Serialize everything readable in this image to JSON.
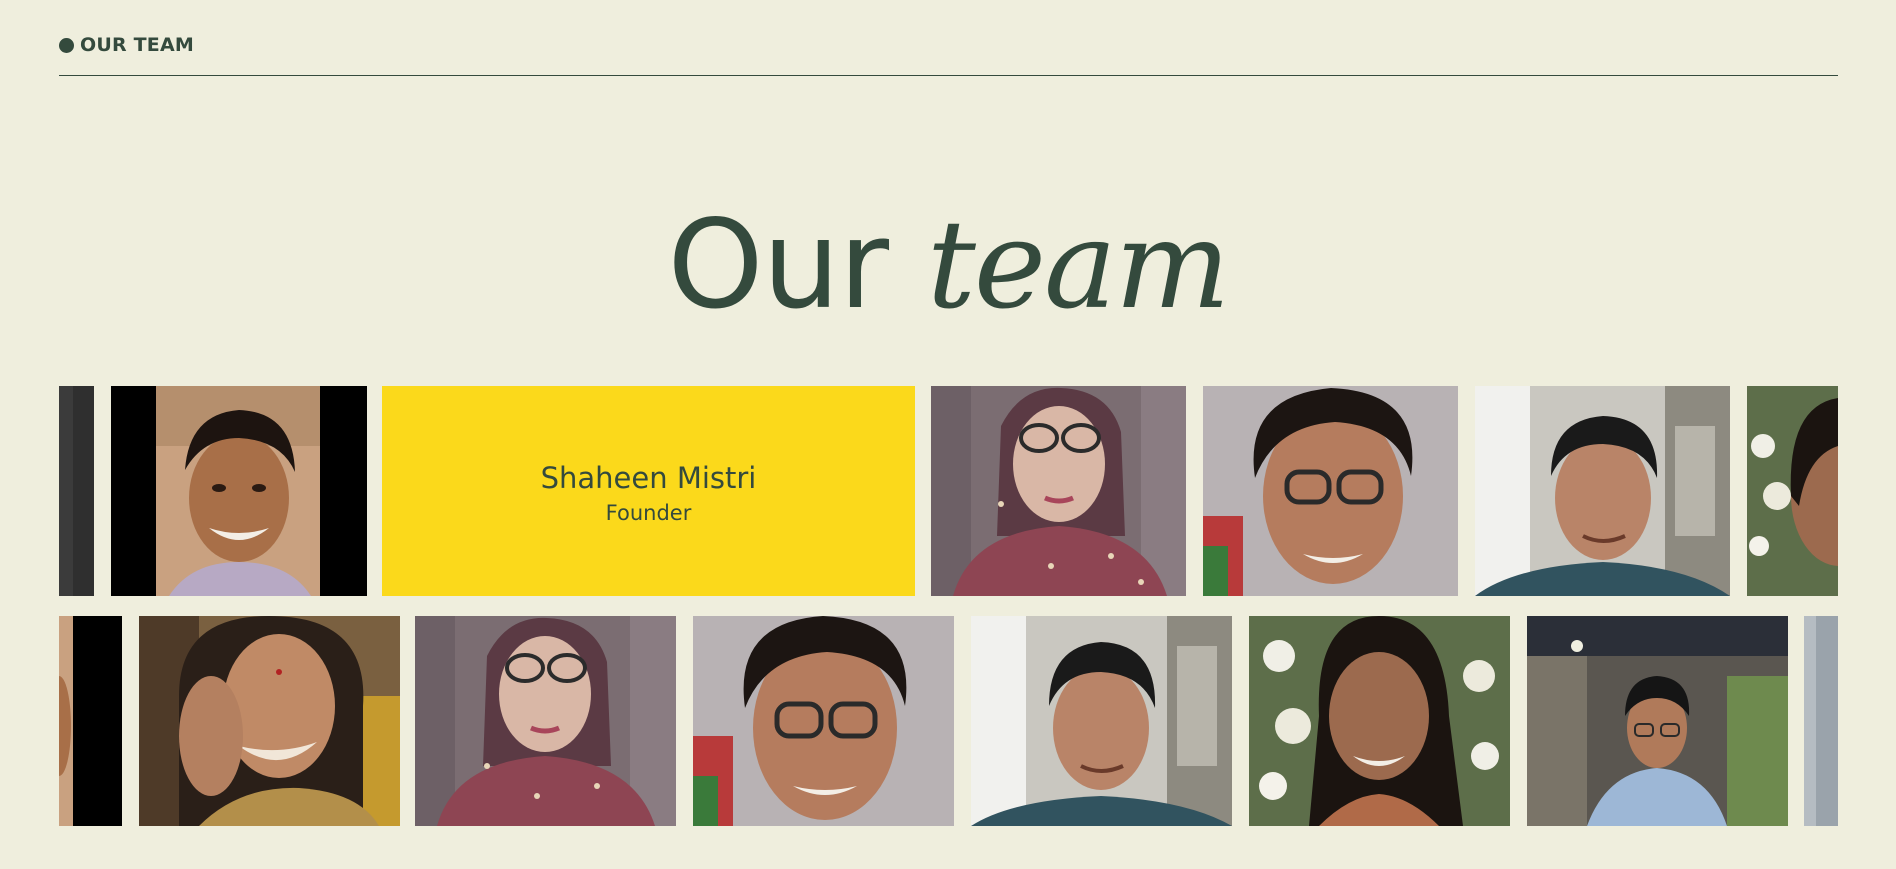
{
  "section": {
    "label": "OUR TEAM"
  },
  "heading": {
    "regular": "Our",
    "italic": "team"
  },
  "featured": {
    "name": "Shaheen Mistri",
    "role": "Founder"
  },
  "colors": {
    "background": "#efeedd",
    "text": "#344a3d",
    "accent_yellow": "#fbd91b"
  },
  "gallery": {
    "row_1": [
      "portrait-partial",
      "portrait-man-smiling",
      "featured-card",
      "portrait-woman-glasses-red-top",
      "portrait-woman-short-hair-glasses",
      "portrait-man-grey-hair",
      "portrait-partial"
    ],
    "row_2": [
      "portrait-partial",
      "portrait-woman-laughing",
      "portrait-woman-glasses-red-top",
      "portrait-woman-short-hair-glasses",
      "portrait-man-grey-hair",
      "portrait-woman-long-hair",
      "portrait-young-man-glasses",
      "portrait-partial"
    ]
  }
}
